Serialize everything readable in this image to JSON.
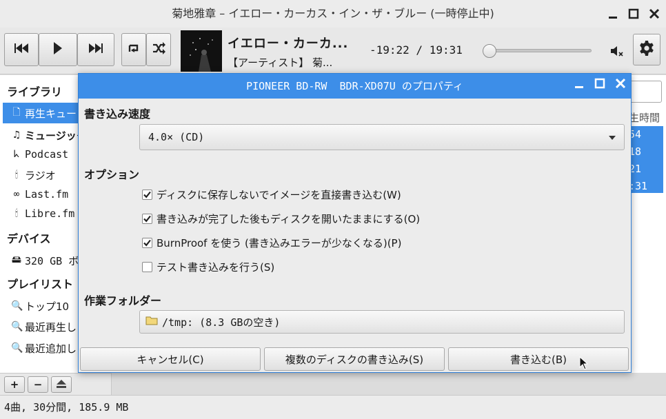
{
  "window": {
    "title": "菊地雅章 – イエロー・カーカス・イン・ザ・ブルー (一時停止中)"
  },
  "player": {
    "track_title": "イエロー・カーカ...",
    "track_artist": "【アーティスト】 菊...",
    "time": "-19:22 / 19:31",
    "seek_position": 0.0,
    "icons": [
      "previous-icon",
      "play-icon",
      "next-icon",
      "repeat-icon",
      "shuffle-icon",
      "mute-icon",
      "gear-icon"
    ]
  },
  "sidebar": {
    "library_heading": "ライブラリ",
    "library_items": [
      {
        "label": "再生キュー",
        "icon": "document-icon",
        "selected": true
      },
      {
        "label": "ミュージック",
        "icon": "music-note-icon"
      },
      {
        "label": "Podcast",
        "icon": "rss-icon"
      },
      {
        "label": "ラジオ",
        "icon": "radio-icon"
      },
      {
        "label": "Last.fm",
        "icon": "lastfm-icon"
      },
      {
        "label": "Libre.fm",
        "icon": "radio-icon"
      }
    ],
    "devices_heading": "デバイス",
    "device_items": [
      {
        "label": "320 GB ボ",
        "icon": "drive-icon"
      }
    ],
    "playlists_heading": "プレイリスト",
    "playlist_items": [
      {
        "label": "トップ10",
        "icon": "search-icon"
      },
      {
        "label": "最近再生し",
        "icon": "search-icon"
      },
      {
        "label": "最近追加し",
        "icon": "search-icon"
      }
    ],
    "bottom_buttons": {
      "add": "+",
      "remove": "−"
    }
  },
  "track_list": {
    "column_header": "生時間",
    "durations": [
      "54",
      "18",
      "21",
      ":31"
    ]
  },
  "status_bar": {
    "text": "4曲, 30分間, 185.9 MB"
  },
  "dialog": {
    "title": "PIONEER BD-RW  BDR-XD07U のプロパティ",
    "speed_heading": "書き込み速度",
    "speed_value": "4.0× (CD)",
    "options_heading": "オプション",
    "options": [
      {
        "label": "ディスクに保存しないでイメージを直接書き込む(W)",
        "checked": true
      },
      {
        "label": "書き込みが完了した後もディスクを開いたままにする(O)",
        "checked": true
      },
      {
        "label": "BurnProof を使う (書き込みエラーが少なくなる)(P)",
        "checked": true
      },
      {
        "label": "テスト書き込みを行う(S)",
        "checked": false
      }
    ],
    "folder_heading": "作業フォルダー",
    "folder_value": "/tmp: (8.3 GBの空き)",
    "buttons": {
      "cancel": "キャンセル(C)",
      "multi": "複数のディスクの書き込み(S)",
      "burn": "書き込む(B)"
    }
  }
}
